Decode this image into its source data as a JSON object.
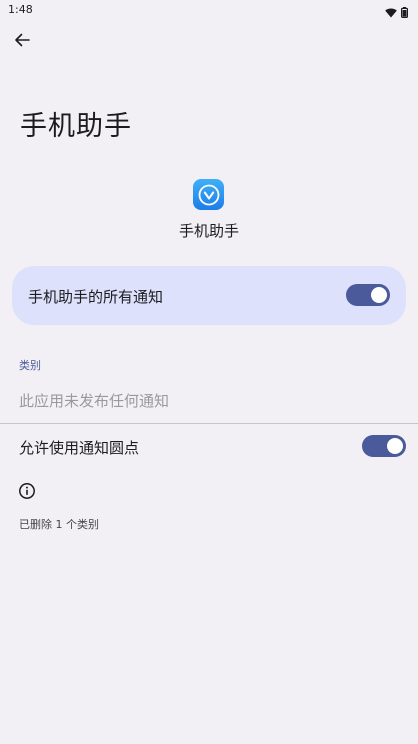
{
  "status_bar": {
    "time": "1:48",
    "icons": [
      "wifi-icon",
      "battery-icon"
    ]
  },
  "header": {
    "back_icon": "arrow-back-icon",
    "title": "手机助手"
  },
  "app": {
    "name": "手机助手",
    "icon": "app-logo-icon",
    "icon_color": "#2a93ef"
  },
  "main_toggle": {
    "label": "手机助手的所有通知",
    "checked": true
  },
  "categories": {
    "header": "类别",
    "empty_text": "此应用未发布任何通知"
  },
  "notification_dot": {
    "label": "允许使用通知圆点",
    "checked": true
  },
  "footer": {
    "info_icon": "info-icon",
    "deleted_text": "已删除 1 个类别"
  },
  "colors": {
    "background": "#f3f0f5",
    "card": "#dde1fb",
    "accent": "#4a5a9b"
  }
}
